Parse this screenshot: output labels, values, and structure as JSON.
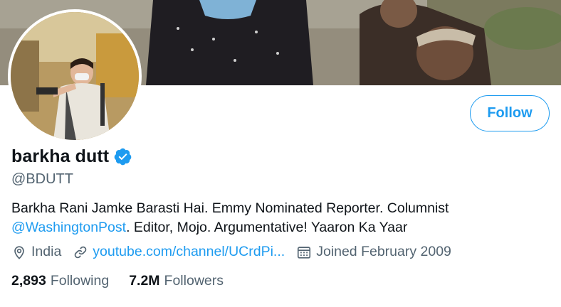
{
  "profile": {
    "display_name": "barkha dutt",
    "handle": "@BDUTT",
    "bio_text_1": "Barkha Rani Jamke Barasti Hai. Emmy Nominated Reporter. Columnist ",
    "bio_mention": "@WashingtonPost",
    "bio_text_2": ". Editor, Mojo. Argumentative! Yaaron Ka Yaar",
    "location": "India",
    "website": "youtube.com/channel/UCrdPi...",
    "joined": "Joined February 2009",
    "following_count": "2,893",
    "following_label": "Following",
    "followers_count": "7.2M",
    "followers_label": "Followers"
  },
  "actions": {
    "follow_label": "Follow"
  },
  "icons": {
    "verified": "verified-badge-icon",
    "location": "location-pin-icon",
    "link": "link-icon",
    "calendar": "calendar-icon"
  },
  "colors": {
    "accent": "#1d9bf0",
    "text_primary": "#0f1419",
    "text_secondary": "#536471"
  }
}
